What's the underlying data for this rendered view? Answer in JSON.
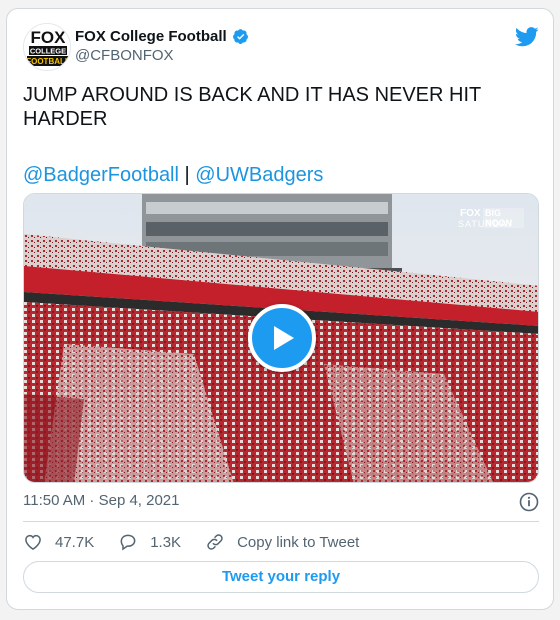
{
  "account": {
    "display_name": "FOX College Football",
    "handle": "@CFBONFOX",
    "avatar_text": [
      "FOX",
      "COLLEGE",
      "FOOTBALL"
    ]
  },
  "tweet": {
    "text": "JUMP AROUND IS BACK AND IT HAS NEVER HIT HARDER",
    "mention_1": "@BadgerFootball",
    "separator": " | ",
    "mention_2": "@UWBadgers",
    "timestamp": "11:50 AM · Sep 4, 2021"
  },
  "media": {
    "network_fox": "FOX",
    "network_bn": "BIG NOON",
    "network_saturday": "SATURDAY"
  },
  "actions": {
    "likes": "47.7K",
    "replies": "1.3K",
    "copy_link": "Copy link to Tweet"
  },
  "reply_button": {
    "label": "Tweet your reply"
  },
  "colors": {
    "accent": "#1d9bf0",
    "mention": "#1b95e0",
    "secondary_text": "#536471",
    "border": "#cfd9de"
  }
}
